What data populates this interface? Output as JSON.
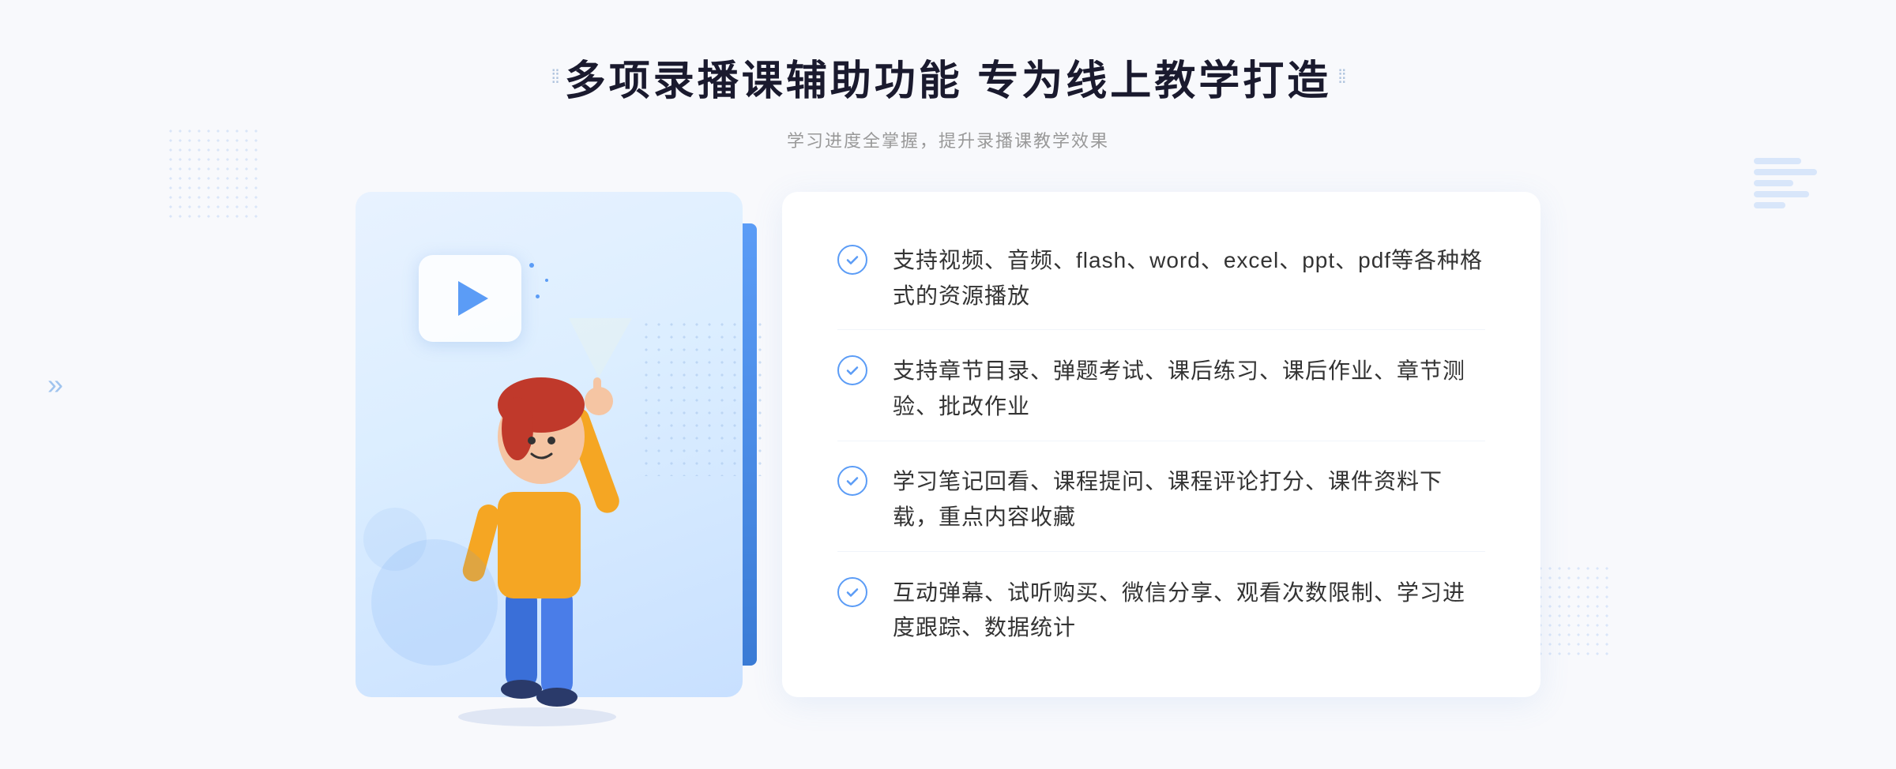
{
  "header": {
    "title": "多项录播课辅助功能 专为线上教学打造",
    "subtitle": "学习进度全掌握，提升录播课教学效果"
  },
  "features": [
    {
      "id": "feature-1",
      "text": "支持视频、音频、flash、word、excel、ppt、pdf等各种格式的资源播放"
    },
    {
      "id": "feature-2",
      "text": "支持章节目录、弹题考试、课后练习、课后作业、章节测验、批改作业"
    },
    {
      "id": "feature-3",
      "text": "学习笔记回看、课程提问、课程评论打分、课件资料下载，重点内容收藏"
    },
    {
      "id": "feature-4",
      "text": "互动弹幕、试听购买、微信分享、观看次数限制、学习进度跟踪、数据统计"
    }
  ],
  "decorators": {
    "header_dots_left": "⁞⁞",
    "header_dots_right": "⁞⁞",
    "chevron": "»"
  }
}
